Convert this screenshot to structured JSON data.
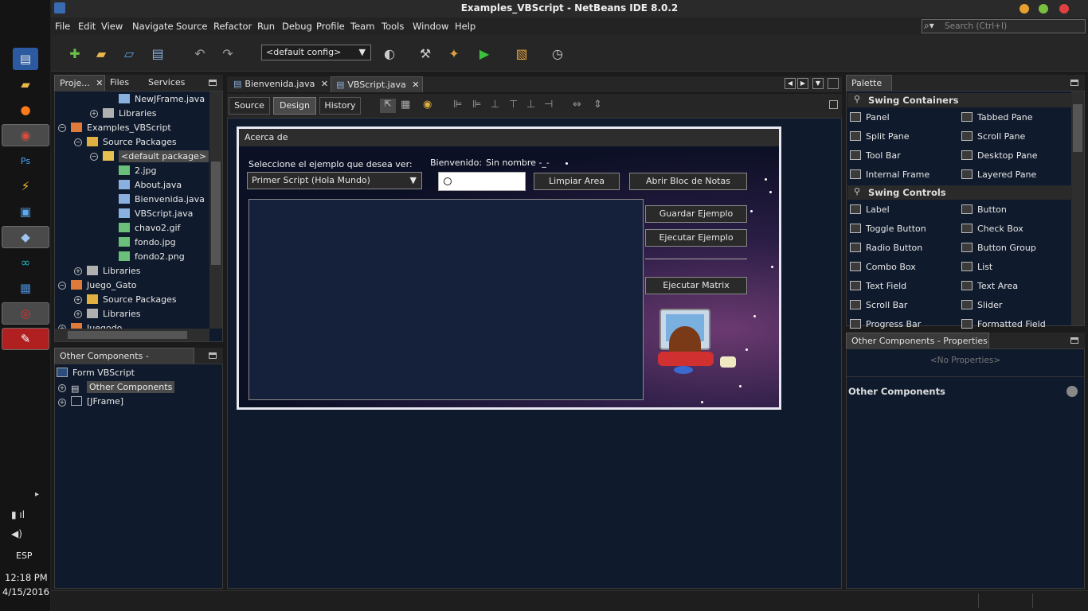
{
  "window": {
    "title": "Examples_VBScript - NetBeans IDE 8.0.2"
  },
  "menu": [
    "File",
    "Edit",
    "View",
    "Navigate",
    "Source",
    "Refactor",
    "Run",
    "Debug",
    "Profile",
    "Team",
    "Tools",
    "Window",
    "Help"
  ],
  "search": {
    "placeholder": "Search (Ctrl+I)"
  },
  "toolbar": {
    "config": "<default config>"
  },
  "projects": {
    "tabs": [
      "Proje...",
      "Files",
      "Services"
    ],
    "tree": [
      {
        "label": "NewJFrame.java",
        "icon": "java-file-icon"
      },
      {
        "label": "Libraries",
        "icon": "library-icon"
      },
      {
        "label": "Examples_VBScript",
        "icon": "project-icon"
      },
      {
        "label": "Source Packages",
        "icon": "package-folder-icon"
      },
      {
        "label": "<default package>",
        "icon": "package-icon"
      },
      {
        "label": "2.jpg",
        "icon": "image-file-icon"
      },
      {
        "label": "About.java",
        "icon": "java-file-icon"
      },
      {
        "label": "Bienvenida.java",
        "icon": "java-file-icon"
      },
      {
        "label": "VBScript.java",
        "icon": "java-file-icon"
      },
      {
        "label": "chavo2.gif",
        "icon": "image-file-icon"
      },
      {
        "label": "fondo.jpg",
        "icon": "image-file-icon"
      },
      {
        "label": "fondo2.png",
        "icon": "image-file-icon"
      },
      {
        "label": "Libraries",
        "icon": "library-icon"
      },
      {
        "label": "Juego_Gato",
        "icon": "project-icon"
      },
      {
        "label": "Source Packages",
        "icon": "package-folder-icon"
      },
      {
        "label": "Libraries",
        "icon": "library-icon"
      },
      {
        "label": "Juegodo",
        "icon": "project-icon"
      }
    ]
  },
  "navigator": {
    "title": "Other Components - Navigator",
    "items": [
      "Form VBScript",
      "Other Components",
      "[JFrame]"
    ]
  },
  "editor": {
    "tabs": [
      "Bienvenida.java",
      "VBScript.java"
    ],
    "views": [
      "Source",
      "Design",
      "History"
    ]
  },
  "form": {
    "title": "Acerca de",
    "select_label": "Seleccione el ejemplo que desea ver:",
    "select_value": "Primer Script (Hola Mundo)",
    "welcome_label": "Bienvenido:",
    "user_label": "Sin nombre -_-",
    "btn_clear": "Limpiar Area",
    "btn_notepad": "Abrir Bloc de Notas",
    "btn_save": "Guardar Ejemplo",
    "btn_run": "Ejecutar Ejemplo",
    "btn_matrix": "Ejecutar Matrix"
  },
  "palette": {
    "title": "Palette",
    "sections": [
      {
        "name": "Swing Containers",
        "items": [
          "Panel",
          "Tabbed Pane",
          "Split Pane",
          "Scroll Pane",
          "Tool Bar",
          "Desktop Pane",
          "Internal Frame",
          "Layered Pane"
        ]
      },
      {
        "name": "Swing Controls",
        "items": [
          "Label",
          "Button",
          "Toggle Button",
          "Check Box",
          "Radio Button",
          "Button Group",
          "Combo Box",
          "List",
          "Text Field",
          "Text Area",
          "Scroll Bar",
          "Slider",
          "Progress Bar",
          "Formatted Field"
        ]
      }
    ]
  },
  "properties": {
    "title": "Other Components - Properties",
    "empty": "<No Properties>",
    "section": "Other Components"
  },
  "system": {
    "lang": "ESP",
    "time": "12:18 PM",
    "date": "4/15/2016"
  },
  "colors": {
    "accent": "#1e5bbf",
    "panel": "#0f1a2c"
  }
}
